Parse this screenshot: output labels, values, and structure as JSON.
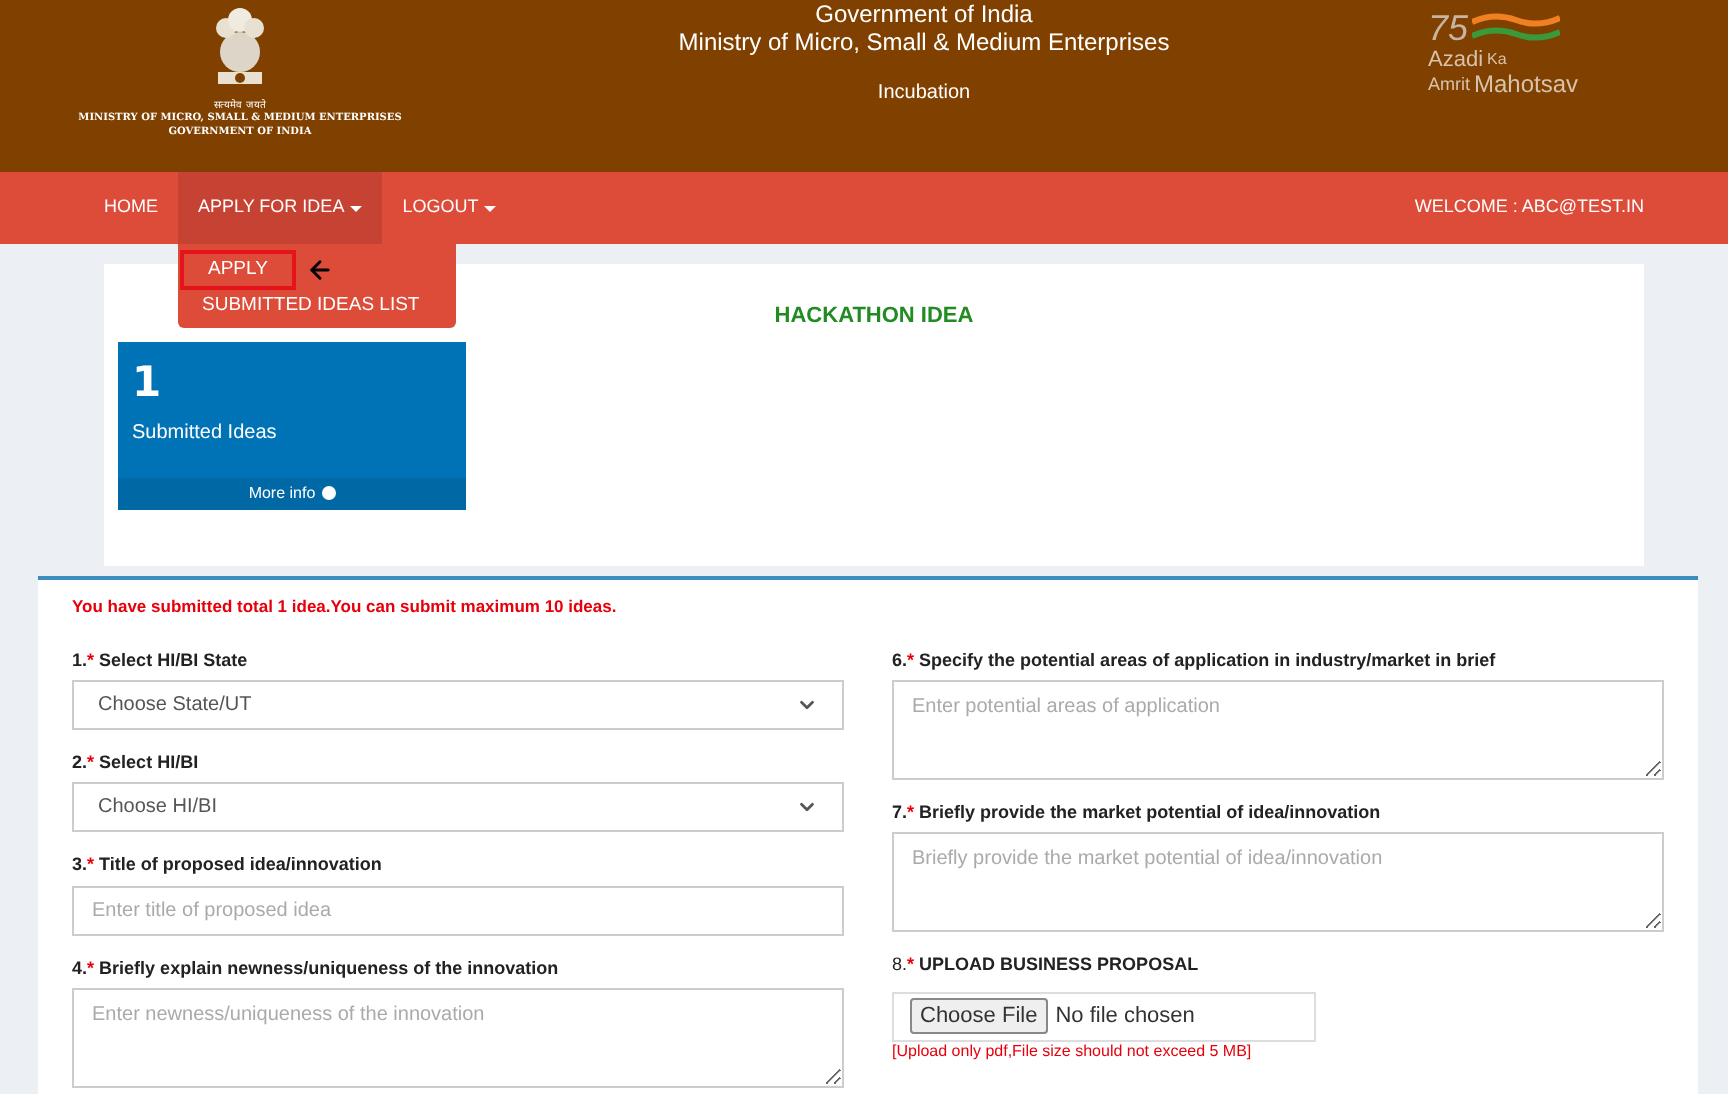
{
  "header": {
    "emblem_motto": "सत्यमेव जयते",
    "emblem_caption": [
      "MINISTRY OF MICRO, SMALL & MEDIUM ENTERPRISES",
      "GOVERNMENT OF INDIA"
    ],
    "title_lines": [
      "Government of India",
      "Ministry of Micro, Small & Medium Enterprises"
    ],
    "subtitle": "Incubation",
    "logo": {
      "number": "75",
      "line_1": "Azadi",
      "line_1_small": "Ka",
      "line_2": "Amrit",
      "line_2_big": "Mahotsav"
    }
  },
  "nav": {
    "items": [
      {
        "label": "HOME",
        "has_caret": false,
        "selected": false
      },
      {
        "label": "APPLY FOR IDEA",
        "has_caret": true,
        "selected": true
      },
      {
        "label": "LOGOUT",
        "has_caret": true,
        "selected": false
      }
    ],
    "welcome": "WELCOME : ABC@TEST.IN",
    "menu": [
      {
        "label": "APPLY",
        "highlighted": true
      },
      {
        "label": "SUBMITTED IDEAS LIST",
        "highlighted": false
      }
    ]
  },
  "page_title": "HACKATHON IDEA",
  "stat_box": {
    "count": "1",
    "label": "Submitted Ideas",
    "link": "More info"
  },
  "form": {
    "message": "You have submitted total 1 idea.You can submit maximum 10 ideas.",
    "left_fields": [
      {
        "number": "1.",
        "marker": "*",
        "label": "Select HI/BI State",
        "kind": "select",
        "placeholder": "Choose State/UT"
      },
      {
        "number": "2.",
        "marker": "*",
        "label": "Select HI/BI",
        "kind": "select",
        "placeholder": "Choose HI/BI"
      },
      {
        "number": "3.",
        "marker": "*",
        "label": "Title of proposed idea/innovation",
        "kind": "input",
        "placeholder": "Enter title of proposed idea"
      },
      {
        "number": "4.",
        "marker": "*",
        "label": "Briefly explain newness/uniqueness of the innovation",
        "kind": "textarea",
        "placeholder": "Enter newness/uniqueness of the innovation"
      }
    ],
    "right_fields": [
      {
        "number": "6.",
        "marker": "*",
        "label": "Specify the potential areas of application in industry/market in brief",
        "kind": "textarea",
        "placeholder": "Enter potential areas of application"
      },
      {
        "number": "7.",
        "marker": "*",
        "label": "Briefly provide the market potential of idea/innovation",
        "kind": "textarea",
        "placeholder": "Briefly provide the market potential of idea/innovation"
      },
      {
        "number": "8.",
        "marker": "*",
        "label": "UPLOAD BUSINESS PROPOSAL",
        "kind": "file",
        "button": "Choose File",
        "status": "No file chosen",
        "note": "[Upload only pdf,File size should not exceed 5 MB]"
      }
    ]
  }
}
